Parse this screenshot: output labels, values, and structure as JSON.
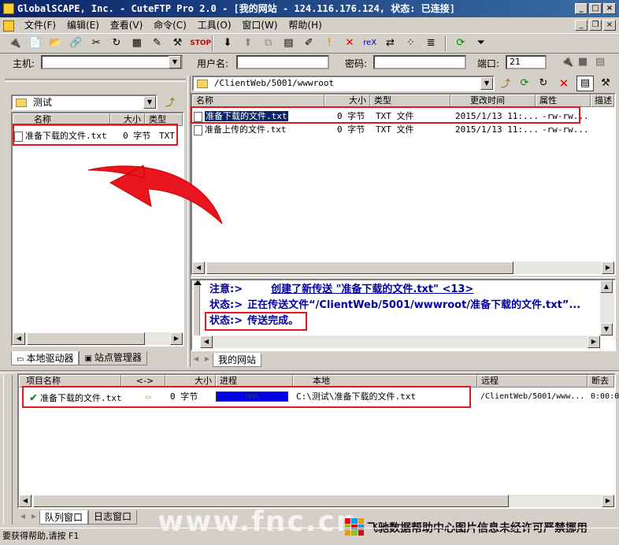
{
  "window": {
    "title": "GlobalSCAPE, Inc. - CuteFTP Pro 2.0 - [我的网站 - 124.116.176.124, 状态: 已连接]"
  },
  "menu": [
    "文件(F)",
    "编辑(E)",
    "查看(V)",
    "命令(C)",
    "工具(O)",
    "窗口(W)",
    "帮助(H)"
  ],
  "connection": {
    "host_label": "主机:",
    "host_value": "",
    "user_label": "用户名:",
    "user_value": "",
    "pass_label": "密码:",
    "pass_value": "",
    "port_label": "端口:",
    "port_value": "21"
  },
  "local": {
    "folder": "测试",
    "columns": [
      "名称",
      "大小",
      "类型"
    ],
    "files": [
      {
        "name": "准备下载的文件.txt",
        "size": "0 字节",
        "type": "TXT."
      }
    ]
  },
  "remote": {
    "path": "/ClientWeb/5001/wwwroot",
    "columns": [
      "名称",
      "大小",
      "类型",
      "更改时间",
      "属性",
      "描述"
    ],
    "files": [
      {
        "name": "准备下载的文件.txt",
        "size": "0 字节",
        "type": "TXT 文件",
        "modified": "2015/1/13 11:...",
        "attrs": "-rw-rw..."
      },
      {
        "name": "准备上传的文件.txt",
        "size": "0 字节",
        "type": "TXT 文件",
        "modified": "2015/1/13 11:...",
        "attrs": "-rw-rw..."
      }
    ]
  },
  "log": [
    {
      "prefix": "注意:>",
      "text": "创建了新传送 \"准备下载的文件.txt\" <13>"
    },
    {
      "prefix": "状态:>",
      "text": "正在传送文件“/ClientWeb/5001/wwwroot/准备下载的文件.txt”..."
    },
    {
      "prefix": "状态:>",
      "text": "传送完成。"
    }
  ],
  "tabs": {
    "local_drives": "本地驱动器",
    "site_manager": "站点管理器",
    "my_site": "我的网站",
    "queue": "队列窗口",
    "log": "日志窗口"
  },
  "queue": {
    "columns": [
      "项目名称",
      "<->",
      "大小",
      "进程",
      "本地",
      "远程",
      "断去"
    ],
    "items": [
      {
        "name": "准备下载的文件.txt",
        "size": "0 字节",
        "progress_label": "100%",
        "progress": 1.0,
        "local": "C:\\测试\\准备下载的文件.txt",
        "remote": "/ClientWeb/5001/www...",
        "time": "0:00:0"
      }
    ]
  },
  "watermark": {
    "site": "www.fnc.cn",
    "text": "飞驰数据帮助中心图片信息未经许可严禁挪用"
  },
  "status": "要获得帮助,请按 F1"
}
